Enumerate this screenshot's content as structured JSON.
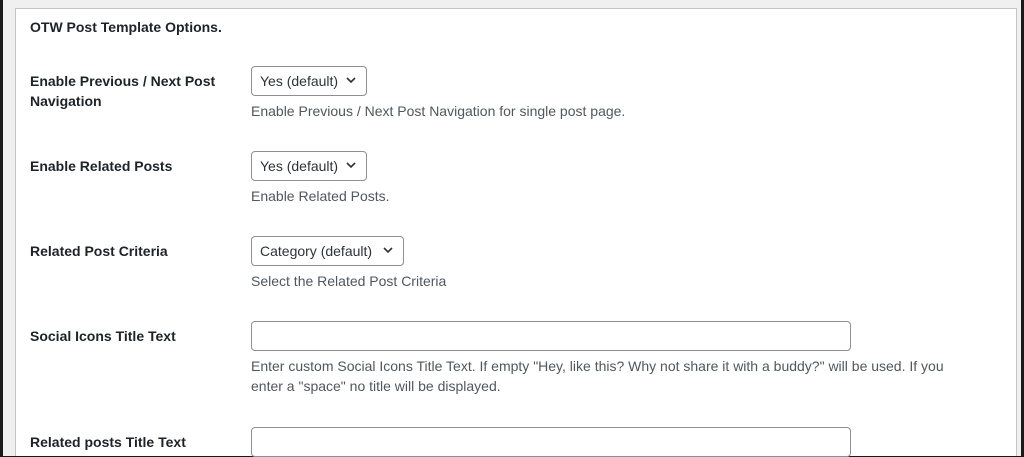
{
  "panel": {
    "title": "OTW Post Template Options."
  },
  "options": [
    {
      "label": "Enable Previous / Next Post Navigation",
      "select_value": "Yes (default)",
      "description": "Enable Previous / Next Post Navigation for single post page."
    },
    {
      "label": "Enable Related Posts",
      "select_value": "Yes (default)",
      "description": "Enable Related Posts."
    },
    {
      "label": "Related Post Criteria",
      "select_value": "Category (default)",
      "description": "Select the Related Post Criteria"
    },
    {
      "label": "Social Icons Title Text",
      "input_value": "",
      "description_line1": "Enter custom Social Icons Title Text. If empty \"Hey, like this? Why not share it with a buddy?\" will be used. If you",
      "description_line2": "enter a \"space\" no title will be displayed."
    },
    {
      "label": "Related posts Title Text",
      "input_value": ""
    }
  ],
  "icons": {
    "select_arrow": "chevron-down-icon"
  }
}
